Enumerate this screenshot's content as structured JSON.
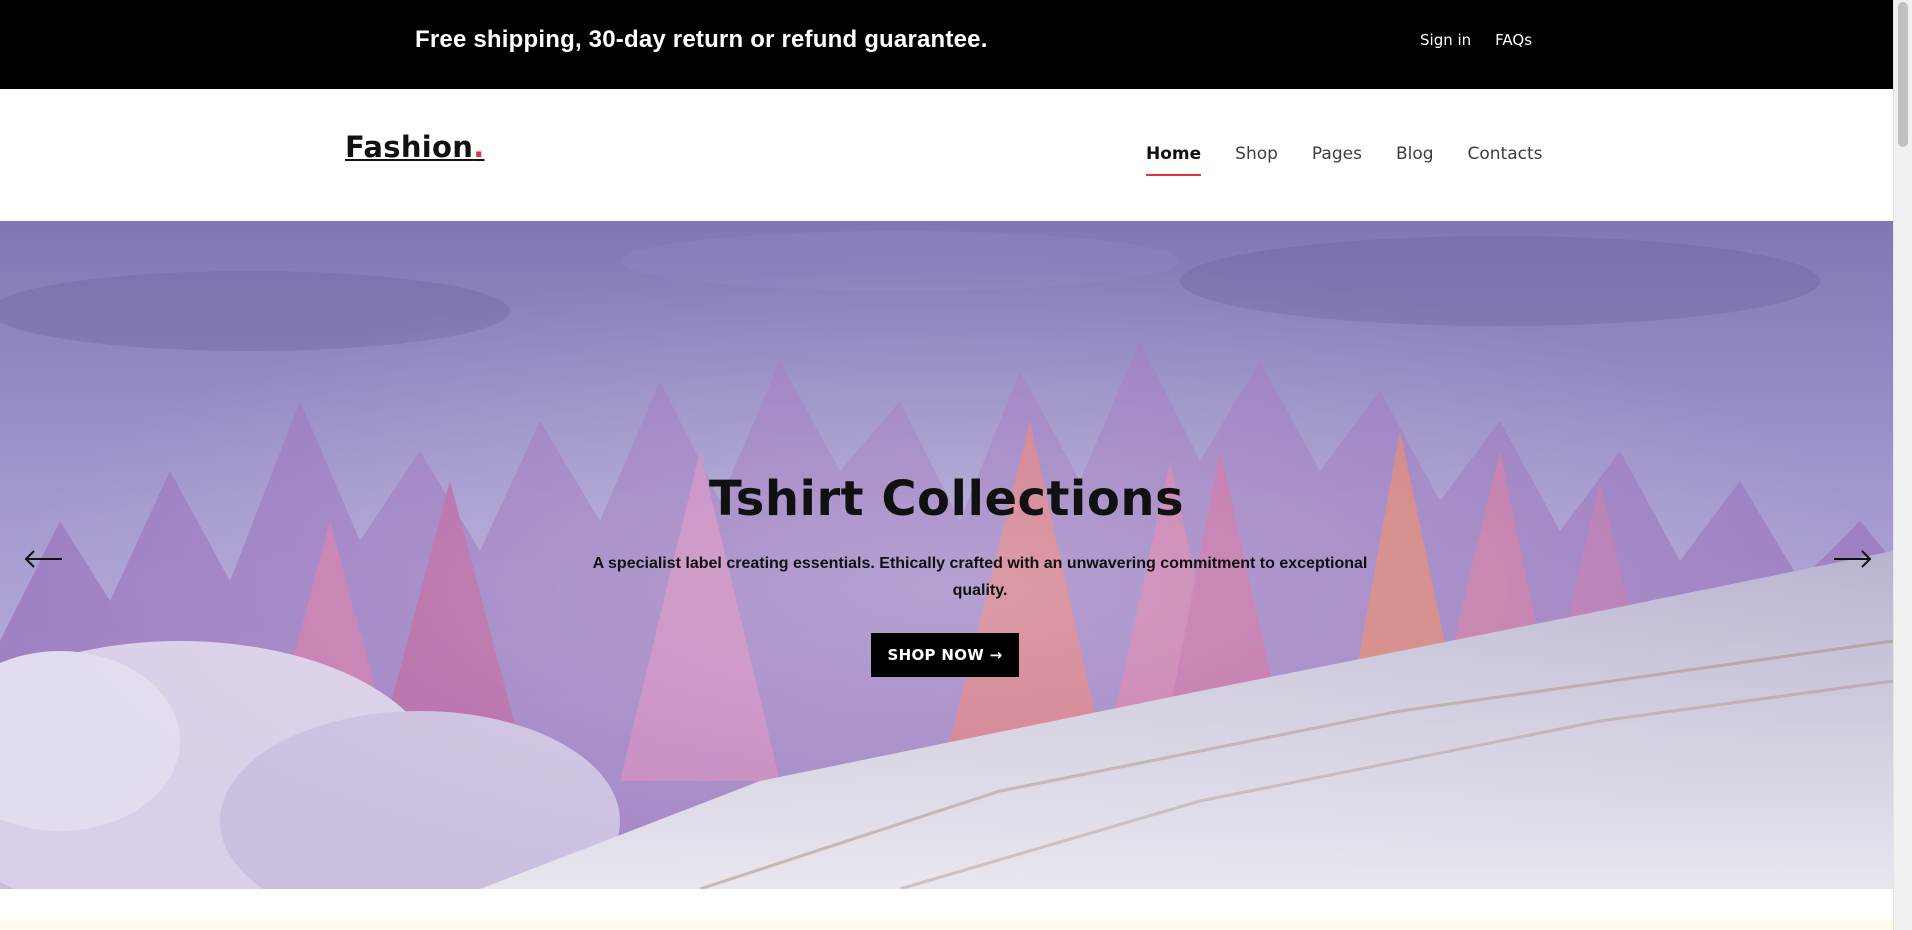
{
  "topbar": {
    "message": "Free shipping, 30-day return or refund guarantee.",
    "links": [
      "Sign in",
      "FAQs"
    ]
  },
  "header": {
    "logo_text": "Fashion",
    "logo_dot": ".",
    "nav": [
      {
        "label": "Home",
        "active": true
      },
      {
        "label": "Shop",
        "active": false
      },
      {
        "label": "Pages",
        "active": false
      },
      {
        "label": "Blog",
        "active": false
      },
      {
        "label": "Contacts",
        "active": false
      }
    ]
  },
  "hero": {
    "title": "Tshirt Collections",
    "description": "A specialist label creating essentials. Ethically crafted with an unwavering commitment to exceptional quality.",
    "button_label": "SHOP NOW →",
    "prev_icon": "arrow-left-icon",
    "next_icon": "arrow-right-icon",
    "image": "winter-frosted-forest-photo"
  },
  "colors": {
    "accent": "#e53637",
    "topbar_bg": "#000000",
    "button_bg": "#000000"
  }
}
